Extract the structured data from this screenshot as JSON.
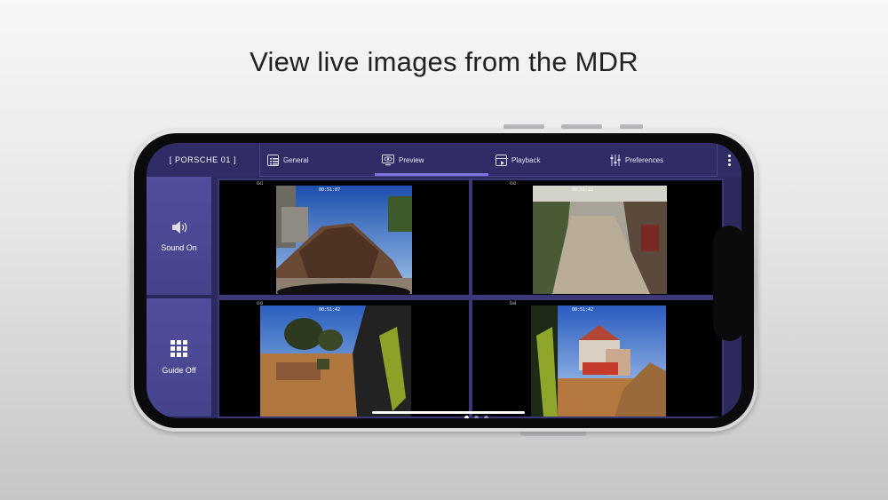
{
  "headline": "View live images from the MDR",
  "app": {
    "device_name": "[ PORSCHE 01 ]",
    "tabs": [
      {
        "label": "General",
        "icon": "general-grid-icon"
      },
      {
        "label": "Preview",
        "icon": "preview-eye-icon",
        "active": true
      },
      {
        "label": "Playback",
        "icon": "playback-calendar-icon"
      },
      {
        "label": "Preferences",
        "icon": "preferences-sliders-icon"
      }
    ],
    "sidebar": [
      {
        "label": "Sound On",
        "icon": "speaker-icon"
      },
      {
        "label": "Guide Off",
        "icon": "grid-icon"
      }
    ],
    "cameras": [
      {
        "channel": "CH1",
        "osd_time": "00:51:07",
        "scene": "gravel heap"
      },
      {
        "channel": "CH2",
        "osd_time": "00:51:22",
        "scene": "dirt track"
      },
      {
        "channel": "CH3",
        "osd_time": "00:51:42",
        "scene": "site view"
      },
      {
        "channel": "CH4",
        "osd_time": "00:51:42",
        "scene": "excavator"
      }
    ],
    "page_dots": {
      "count": 3,
      "active": 1
    }
  },
  "colors": {
    "topbar": "#2f2c66",
    "sidebar_button": "#4e4b99",
    "accent": "#7c74e0"
  }
}
